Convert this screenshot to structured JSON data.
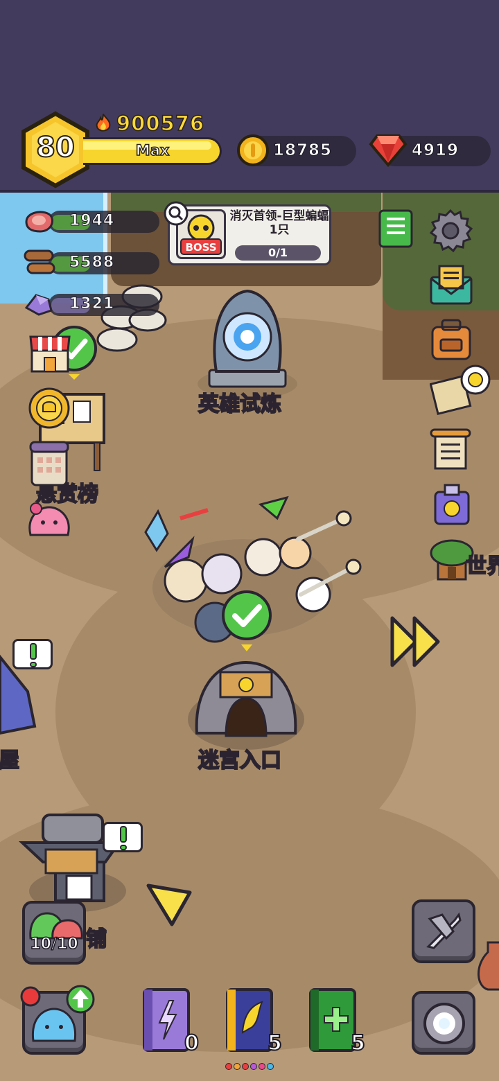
{
  "player": {
    "level": "80",
    "power": "900576",
    "xp_label": "Max"
  },
  "currency": {
    "gold": "18785",
    "gems": "4919"
  },
  "resources": [
    {
      "name": "meat",
      "value": "1944"
    },
    {
      "name": "wood",
      "value": "5588"
    },
    {
      "name": "ore",
      "value": "1321"
    }
  ],
  "quest": {
    "boss_tag": "BOSS",
    "title": "消灭首领-巨型蝙蝠1只",
    "progress": "0/1"
  },
  "map_labels": {
    "hero_trial": "英雄试炼",
    "bounty_board": "悬赏榜",
    "maze_entrance": "迷宫入口",
    "world_partial": "世界",
    "house_partial": "屋",
    "shop_partial": "铺"
  },
  "slime_capacity": "10/10",
  "books": [
    {
      "name": "lightning-book",
      "count": "0"
    },
    {
      "name": "wing-book",
      "count": "5"
    },
    {
      "name": "heal-book",
      "count": "5"
    }
  ],
  "colors": {
    "topbar": "#433b5e",
    "accent_yellow": "#f7d52d",
    "check_green": "#53c64a",
    "gem_red": "#e8413a"
  }
}
